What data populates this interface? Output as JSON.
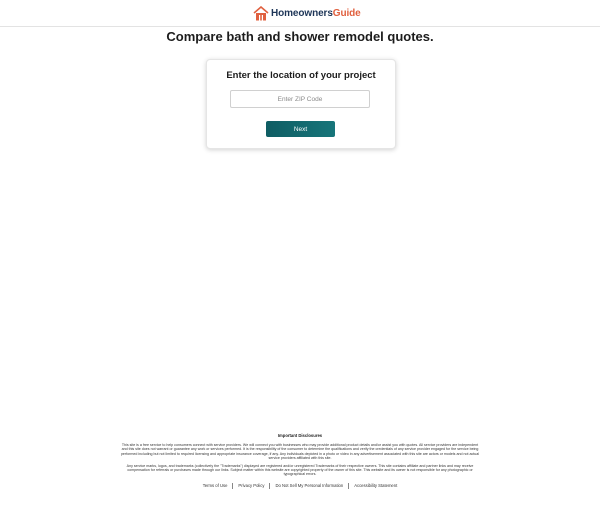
{
  "header": {
    "logo_part1": "Homeowners",
    "logo_part2": "Guide"
  },
  "headline": "Compare bath and shower remodel quotes.",
  "form": {
    "title": "Enter the location of your project",
    "zip_placeholder": "Enter ZIP Code",
    "zip_value": "",
    "next_label": "Next"
  },
  "disclosures": {
    "title": "Important Disclosures",
    "paragraph1": "This site is a free service to help consumers connect with service providers. We will connect you with businesses who may provide additional product details and/or assist you with quotes. All service providers are independent and this site does not warrant or guarantee any work or services performed. It is the responsibility of the consumer to determine the qualifications and verify the credentials of any service provider engaged for the service being performed including but not limited to required licensing and appropriate insurance coverage, if any. Any individuals depicted in a photo or video in any advertisement associated with this site are actors or models and not actual service providers affiliated with this site.",
    "paragraph2": "Any service marks, logos, and trademarks (collectively the \"Trademarks\") displayed are registered and/or unregistered Trademarks of their respective owners. This site contains affiliate and partner links and may receive compensation for referrals or purchases made through our links. Subject matter within this website are copyrighted property of the owner of this site. This website and its owner is not responsible for any photographic or typographical errors."
  },
  "footer_links": [
    "Terms of Use",
    "Privacy Policy",
    "Do Not Sell My Personal Information",
    "Accessibility Statement"
  ],
  "colors": {
    "brand_navy": "#1d3557",
    "brand_orange": "#e0603f",
    "button_teal": "#0f5d63"
  }
}
